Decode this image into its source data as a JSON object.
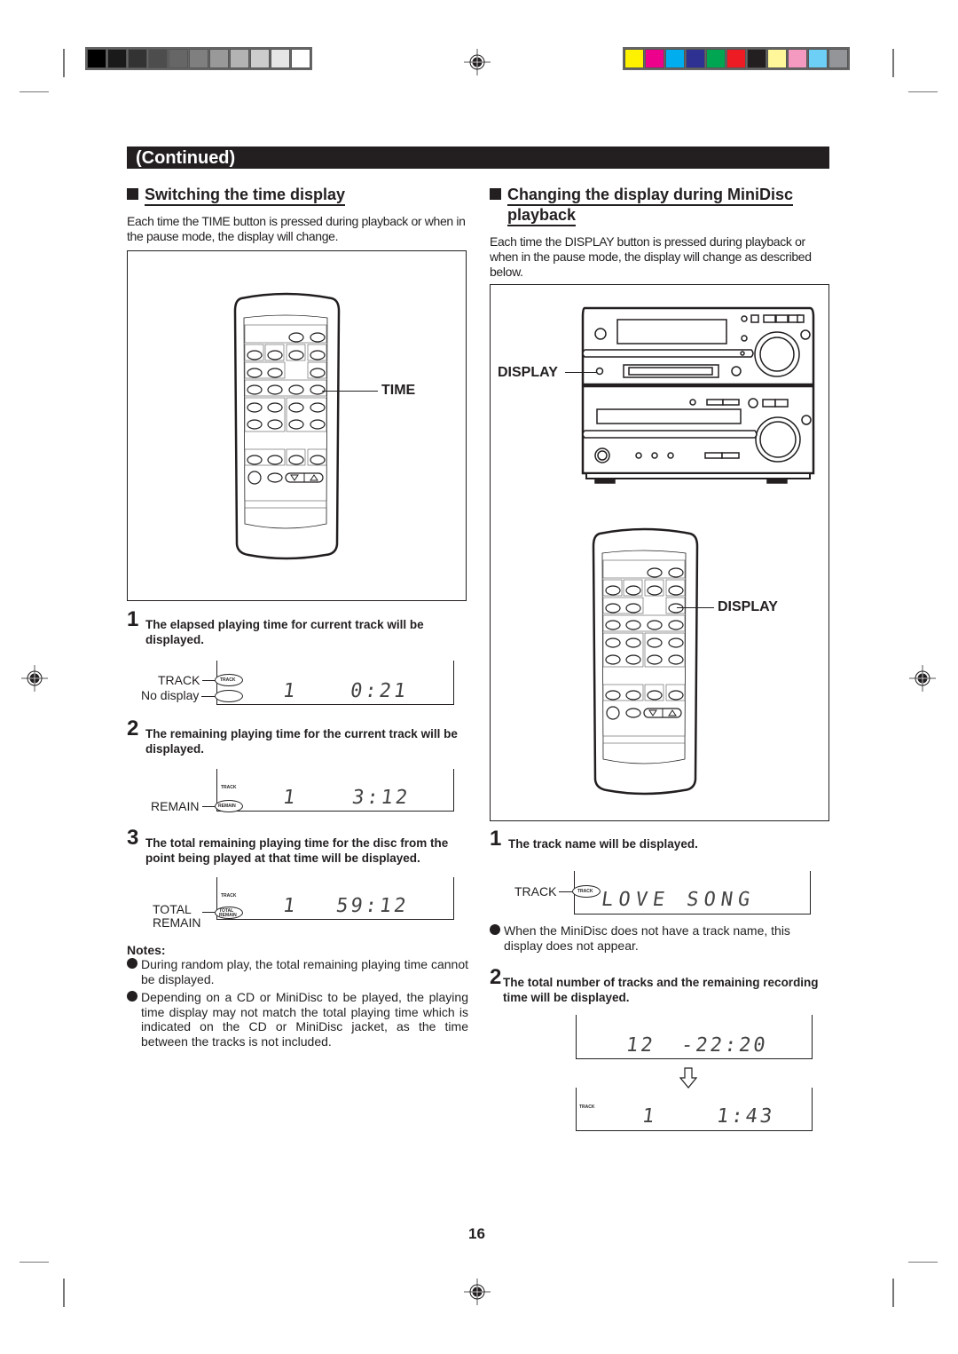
{
  "print_marks": {
    "grayscale_swatches": [
      "#000000",
      "#1a1a1a",
      "#333333",
      "#4d4d4d",
      "#666666",
      "#7f7f7f",
      "#999999",
      "#b3b3b3",
      "#cccccc",
      "#e6e6e6",
      "#ffffff"
    ],
    "color_swatches": [
      "#fff200",
      "#ec008c",
      "#00aeef",
      "#2e3192",
      "#00a651",
      "#ed1c24",
      "#231f20",
      "#fff799",
      "#f49ac1",
      "#6dcff6",
      "#939598"
    ]
  },
  "banner": {
    "label": "(Continued)"
  },
  "left": {
    "heading": "Switching the time display",
    "intro": "Each time the TIME button is pressed during playback or when in the pause mode, the display will change.",
    "figure": {
      "callout": "TIME",
      "icon": "remote-control-icon"
    },
    "steps": [
      {
        "number": "1",
        "text": "The elapsed playing time for current track will be displayed.",
        "display": {
          "track": "1",
          "time": "0:21",
          "indicators": [
            "TRACK"
          ]
        },
        "labels": [
          "TRACK",
          "No display"
        ]
      },
      {
        "number": "2",
        "text": "The remaining playing time for the current track will be displayed.",
        "display": {
          "track": "1",
          "time": "3:12",
          "indicators": [
            "TRACK",
            "REMAIN"
          ]
        },
        "labels": [
          "REMAIN"
        ]
      },
      {
        "number": "3",
        "text": "The total remaining playing time for the disc from the point being played at that time will be displayed.",
        "display": {
          "track": "1",
          "time": "59:12",
          "indicators": [
            "TRACK",
            "TOTAL",
            "REMAIN"
          ]
        },
        "labels": [
          "TOTAL",
          "REMAIN"
        ]
      }
    ],
    "notes_title": "Notes:",
    "notes": [
      "During random play, the total remaining playing time cannot be displayed.",
      "Depending on a CD or MiniDisc to be played, the playing time display may not match the total playing time which is indicated on the CD or MiniDisc jacket, as the time between the tracks is not included."
    ]
  },
  "right": {
    "heading_line1": "Changing the display during MiniDisc",
    "heading_line2": "playback",
    "intro": "Each time the DISPLAY button is pressed during playback or when in the pause mode, the display will change as described below.",
    "figure": {
      "unit_callout": "DISPLAY",
      "remote_callout": "DISPLAY"
    },
    "steps": [
      {
        "number": "1",
        "text": "The track name will be displayed.",
        "display": {
          "text": "LOVE SONG",
          "indicators": [
            "TRACK"
          ]
        },
        "labels": [
          "TRACK"
        ],
        "note": "When the MiniDisc does not have a track name, this display does not appear."
      },
      {
        "number": "2",
        "text": "The total number of tracks and the remaining recording time will be displayed.",
        "displays": [
          {
            "tracks": "12",
            "time": "-22:20",
            "indicators": []
          },
          {
            "track": "1",
            "time": "1:43",
            "indicators": [
              "TRACK"
            ]
          }
        ]
      }
    ]
  },
  "page_number": "16"
}
